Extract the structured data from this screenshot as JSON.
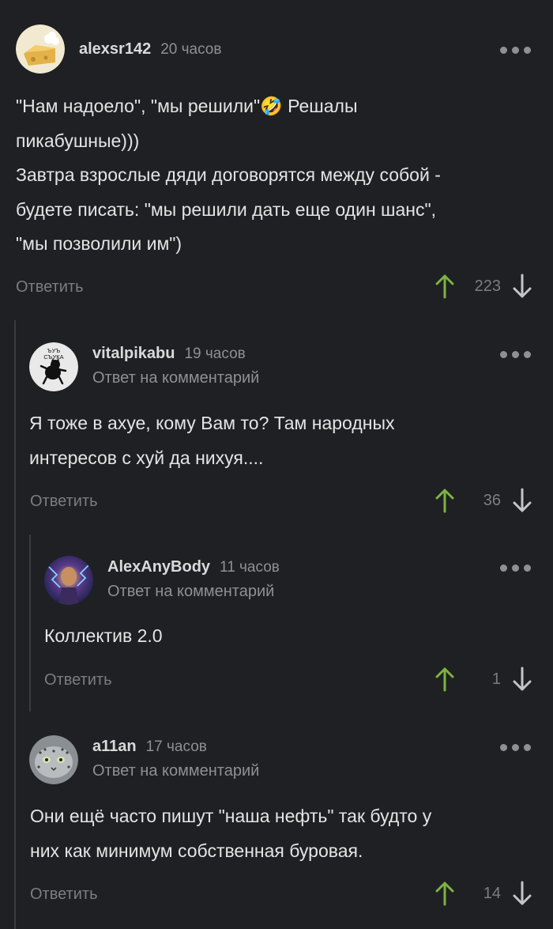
{
  "comments": [
    {
      "user": "alexsr142",
      "time": "20 часов",
      "reply_to": "",
      "lines": [
        "\"Нам надоело\", \"мы решили\"🤣 Решалы",
        "пикабушные)))",
        "Завтра взрослые дяди договорятся между собой -",
        "будете писать: \"мы решили дать еще один шанс\",",
        "\"мы позволили им\")"
      ],
      "reply_label": "Ответить",
      "votes": "223"
    },
    {
      "user": "vitalpikabu",
      "time": "19 часов",
      "reply_to": "Ответ на комментарий",
      "avatar_text": "ЪУЪ СЪУКА",
      "lines": [
        "Я тоже в ахуе, кому Вам то? Там народных",
        "интересов с хуй да нихуя...."
      ],
      "reply_label": "Ответить",
      "votes": "36"
    },
    {
      "user": "AlexAnyBody",
      "time": "11 часов",
      "reply_to": "Ответ на комментарий",
      "lines": [
        "Коллектив 2.0"
      ],
      "reply_label": "Ответить",
      "votes": "1"
    },
    {
      "user": "a11an",
      "time": "17 часов",
      "reply_to": "Ответ на комментарий",
      "lines": [
        "Они ещё часто пишут \"наша нефть\" так будто у",
        "них как минимум собственная буровая."
      ],
      "reply_label": "Ответить",
      "votes": "14"
    }
  ],
  "colors": {
    "background": "#1f2023",
    "upvote": "#7cb342",
    "muted": "#8e9094"
  },
  "icons": [
    "more-dots-icon",
    "upvote-arrow-icon",
    "downvote-arrow-icon"
  ]
}
